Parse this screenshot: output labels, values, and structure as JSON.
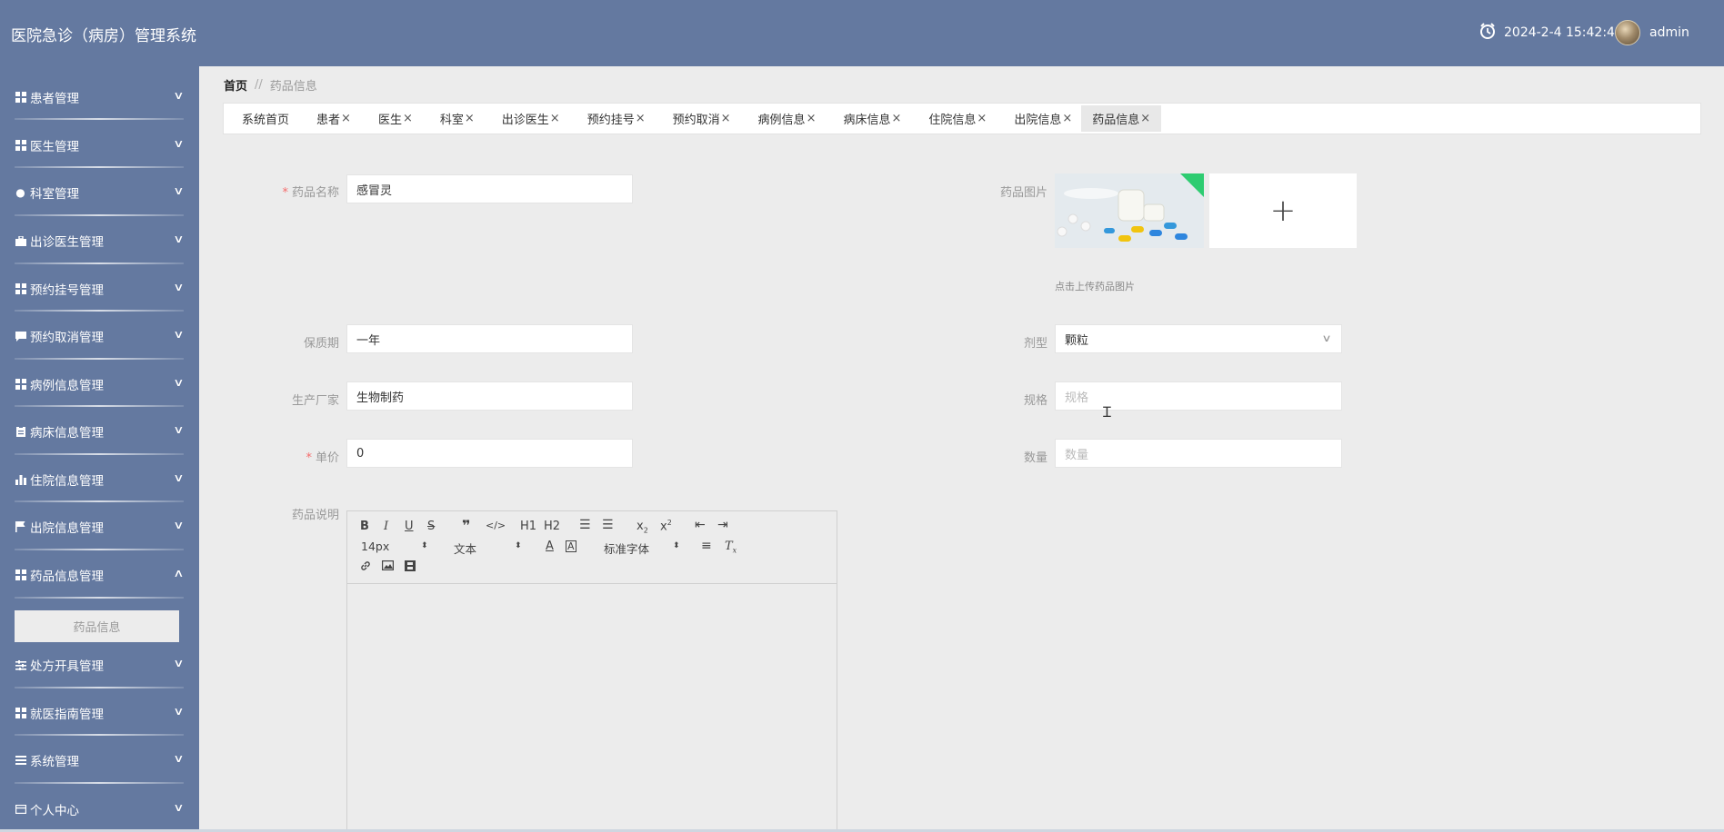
{
  "header": {
    "title": "医院急诊（病房）管理系统",
    "datetime": "2024-2-4 15:42:42",
    "username": "admin"
  },
  "sidebar": {
    "items": [
      {
        "label": "患者管理",
        "icon": "grid-icon"
      },
      {
        "label": "医生管理",
        "icon": "grid-icon"
      },
      {
        "label": "科室管理",
        "icon": "pin-icon"
      },
      {
        "label": "出诊医生管理",
        "icon": "briefcase-icon"
      },
      {
        "label": "预约挂号管理",
        "icon": "grid-icon"
      },
      {
        "label": "预约取消管理",
        "icon": "chat-icon"
      },
      {
        "label": "病例信息管理",
        "icon": "grid-icon"
      },
      {
        "label": "病床信息管理",
        "icon": "clipboard-icon"
      },
      {
        "label": "住院信息管理",
        "icon": "bar-chart-icon"
      },
      {
        "label": "出院信息管理",
        "icon": "flag-icon"
      },
      {
        "label": "药品信息管理",
        "icon": "grid-icon"
      },
      {
        "label": "处方开具管理",
        "icon": "sliders-icon"
      },
      {
        "label": "就医指南管理",
        "icon": "grid-icon"
      },
      {
        "label": "系统管理",
        "icon": "list-icon"
      },
      {
        "label": "个人中心",
        "icon": "card-icon"
      }
    ],
    "expanded_sub": "药品信息"
  },
  "breadcrumb": {
    "home": "首页",
    "separator": "//",
    "current": "药品信息"
  },
  "tabs": [
    {
      "label": "系统首页",
      "closable": false
    },
    {
      "label": "患者",
      "closable": true
    },
    {
      "label": "医生",
      "closable": true
    },
    {
      "label": "科室",
      "closable": true
    },
    {
      "label": "出诊医生",
      "closable": true
    },
    {
      "label": "预约挂号",
      "closable": true
    },
    {
      "label": "预约取消",
      "closable": true
    },
    {
      "label": "病例信息",
      "closable": true
    },
    {
      "label": "病床信息",
      "closable": true
    },
    {
      "label": "住院信息",
      "closable": true
    },
    {
      "label": "出院信息",
      "closable": true
    },
    {
      "label": "药品信息",
      "closable": true,
      "active": true
    }
  ],
  "tab_close_glyph": "×",
  "form": {
    "name": {
      "label": "药品名称",
      "required": true,
      "value": "感冒灵"
    },
    "image": {
      "label": "药品图片",
      "hint": "点击上传药品图片",
      "add_glyph": "+"
    },
    "shelf_life": {
      "label": "保质期",
      "value": "一年"
    },
    "dosage_form": {
      "label": "剂型",
      "value": "颗粒"
    },
    "manufacturer": {
      "label": "生产厂家",
      "value": "生物制药"
    },
    "spec": {
      "label": "规格",
      "placeholder": "规格"
    },
    "price": {
      "label": "单价",
      "required": true,
      "value": "0"
    },
    "quantity": {
      "label": "数量",
      "placeholder": "数量"
    },
    "description": {
      "label": "药品说明"
    }
  },
  "required_mark": "*",
  "editor": {
    "font_size": "14px",
    "header_select": "文本",
    "font_family": "标准字体",
    "h1": "H1",
    "h2": "H2"
  },
  "colors": {
    "header_bg": "#6479a0",
    "sidebar_bg": "#6479a0",
    "content_bg": "#ececec",
    "required": "#f56c6c",
    "image_corner": "#2ecc71"
  }
}
